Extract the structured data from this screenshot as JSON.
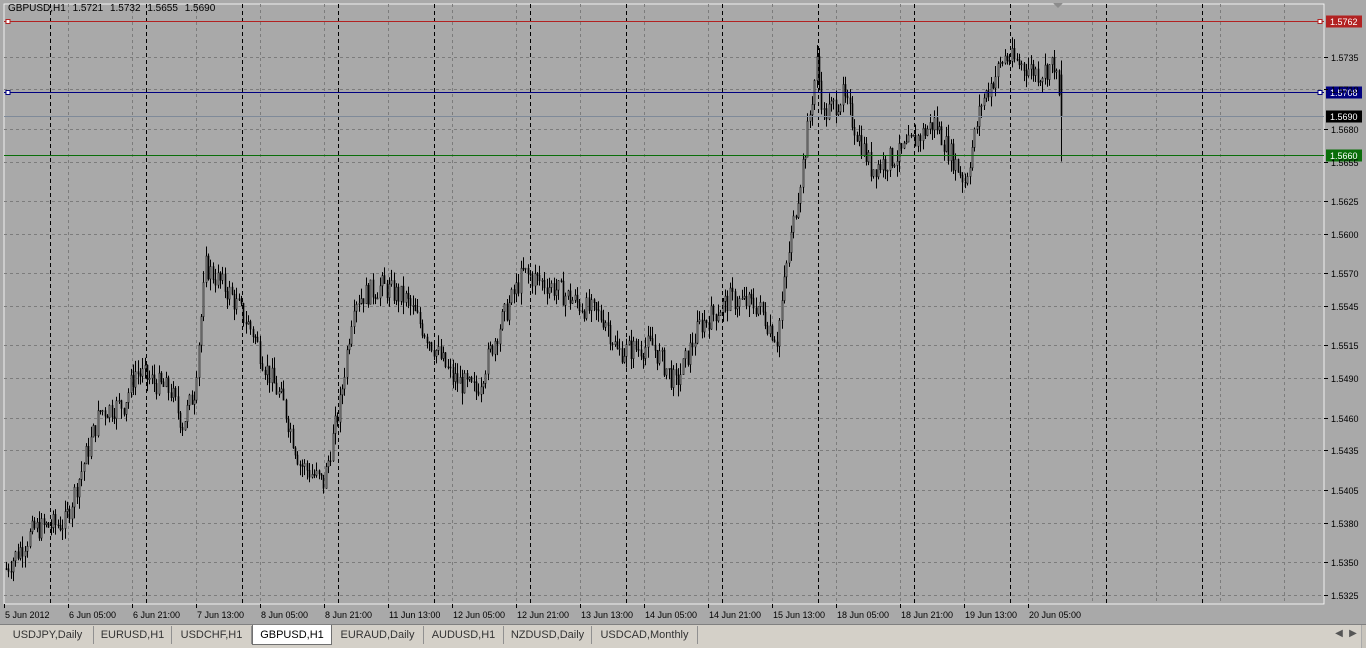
{
  "chart": {
    "symbol": "GBPUSD,H1",
    "ohlc": [
      "1.5721",
      "1.5732",
      "1.5655",
      "1.5690"
    ],
    "price_labels": [
      "1.5735",
      "1.5710",
      "1.5680",
      "1.5655",
      "1.5625",
      "1.5600",
      "1.5570",
      "1.5545",
      "1.5515",
      "1.5490",
      "1.5460",
      "1.5435",
      "1.5405",
      "1.5380",
      "1.5350",
      "1.5325"
    ],
    "time_labels": [
      "5 Jun 2012",
      "6 Jun 05:00",
      "6 Jun 21:00",
      "7 Jun 13:00",
      "8 Jun 05:00",
      "8 Jun 21:00",
      "11 Jun 13:00",
      "12 Jun 05:00",
      "12 Jun 21:00",
      "13 Jun 13:00",
      "14 Jun 05:00",
      "14 Jun 21:00",
      "15 Jun 13:00",
      "18 Jun 05:00",
      "18 Jun 21:00",
      "19 Jun 13:00",
      "20 Jun 05:00"
    ],
    "y_range": [
      1.5318,
      1.5775
    ],
    "bars_count": 360,
    "lines": {
      "red": {
        "price": 1.5762,
        "label": "1.5762",
        "color": "#b22222"
      },
      "blue": {
        "price": 1.5708,
        "label": "1.5708",
        "color": "#000080"
      },
      "current": {
        "price": 1.569,
        "label": "1.5690",
        "color": "#7f8a99"
      },
      "green": {
        "price": 1.566,
        "label": "1.5660",
        "color": "#0a6e0a"
      }
    },
    "colors": {
      "background": "#a9a9a9",
      "grid": "#7c7c7c",
      "candle": "#000000",
      "bull_fill": "#ffffff",
      "bear_fill": "#000000"
    },
    "price_anchors": [
      [
        0,
        1.5345
      ],
      [
        12,
        1.5375
      ],
      [
        25,
        1.538
      ],
      [
        40,
        1.5465
      ],
      [
        50,
        1.547
      ],
      [
        55,
        1.5495
      ],
      [
        60,
        1.549
      ],
      [
        70,
        1.548
      ],
      [
        75,
        1.5455
      ],
      [
        80,
        1.548
      ],
      [
        85,
        1.5575
      ],
      [
        95,
        1.5555
      ],
      [
        105,
        1.5525
      ],
      [
        110,
        1.55
      ],
      [
        118,
        1.547
      ],
      [
        125,
        1.5425
      ],
      [
        135,
        1.541
      ],
      [
        142,
        1.547
      ],
      [
        148,
        1.555
      ],
      [
        160,
        1.556
      ],
      [
        170,
        1.555
      ],
      [
        180,
        1.552
      ],
      [
        190,
        1.549
      ],
      [
        200,
        1.548
      ],
      [
        210,
        1.553
      ],
      [
        220,
        1.557
      ],
      [
        232,
        1.556
      ],
      [
        245,
        1.5545
      ],
      [
        255,
        1.5535
      ],
      [
        260,
        1.551
      ],
      [
        275,
        1.5515
      ],
      [
        285,
        1.5485
      ],
      [
        295,
        1.553
      ],
      [
        308,
        1.555
      ],
      [
        320,
        1.5545
      ],
      [
        328,
        1.552
      ],
      [
        332,
        1.5575
      ],
      [
        340,
        1.5665
      ],
      [
        345,
        1.573
      ],
      [
        348,
        1.569
      ],
      [
        356,
        1.5705
      ],
      [
        368,
        1.565
      ],
      [
        380,
        1.566
      ],
      [
        395,
        1.5685
      ],
      [
        408,
        1.564
      ],
      [
        415,
        1.57
      ],
      [
        425,
        1.5735
      ],
      [
        440,
        1.5722
      ],
      [
        446,
        1.573
      ],
      [
        449,
        1.569
      ]
    ]
  },
  "tabs": [
    {
      "label": "USDJPY,Daily"
    },
    {
      "label": "EURUSD,H1"
    },
    {
      "label": "USDCHF,H1"
    },
    {
      "label": "GBPUSD,H1"
    },
    {
      "label": "EURAUD,Daily"
    },
    {
      "label": "AUDUSD,H1"
    },
    {
      "label": "NZDUSD,Daily"
    },
    {
      "label": "USDCAD,Monthly"
    }
  ],
  "active_tab": "GBPUSD,H1",
  "icons": {
    "scroll_left": "triangle-left",
    "scroll_right": "triangle-right",
    "shift_marker": "triangle-down"
  }
}
